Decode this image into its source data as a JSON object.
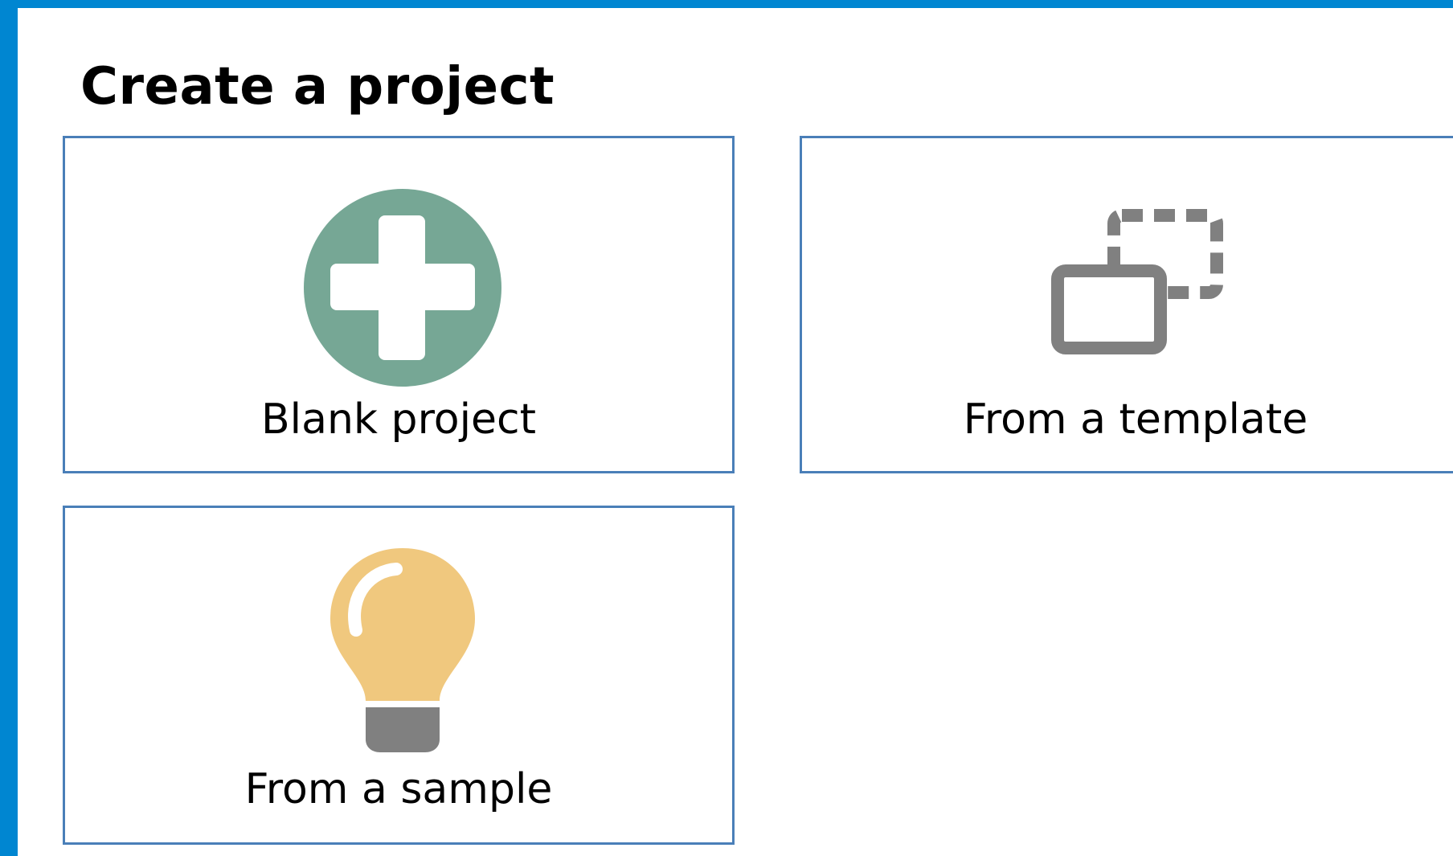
{
  "page": {
    "title": "Create a project",
    "accent_color": "#0086d1",
    "card_border_color": "#4a7fb8"
  },
  "options": [
    {
      "label": "Blank project",
      "icon": "plus-circle-icon",
      "icon_color": "#76a795"
    },
    {
      "label": "From a template",
      "icon": "template-copy-icon",
      "icon_color": "#808080"
    },
    {
      "label": "From a sample",
      "icon": "lightbulb-icon",
      "icon_color": "#f0c87e"
    }
  ]
}
